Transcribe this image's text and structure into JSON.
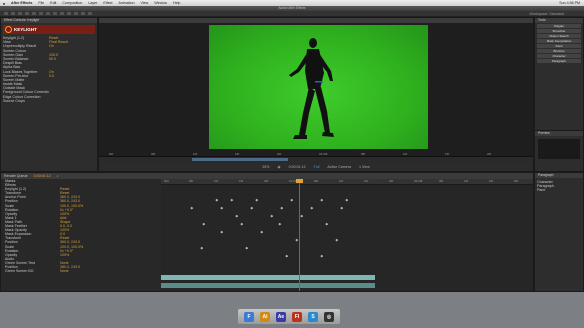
{
  "menubar": {
    "app": "After Effects",
    "items": [
      "File",
      "Edit",
      "Composition",
      "Layer",
      "Effect",
      "Animation",
      "View",
      "Window",
      "Help"
    ],
    "right": [
      "Sun 4:56 PM"
    ]
  },
  "titlebar": {
    "title": "Adobe After Effects"
  },
  "toolsbar": {
    "workspace": "Workspace: Standard"
  },
  "effects": {
    "tab": "Effect Controls: Keylight",
    "plugin_name": "KEYLIGHT",
    "rows": [
      {
        "label": "Keylight (1.2)",
        "value": "Reset"
      },
      {
        "label": "View",
        "value": "Final Result"
      },
      {
        "label": "Unpremultiply Result",
        "value": "On"
      },
      {
        "label": "Screen Colour",
        "value": ""
      },
      {
        "label": "Screen Gain",
        "value": "100.0"
      },
      {
        "label": "Screen Balance",
        "value": "50.0"
      },
      {
        "label": "Despill Bias",
        "value": ""
      },
      {
        "label": "Alpha Bias",
        "value": ""
      },
      {
        "label": "Lock Biases Together",
        "value": "On"
      },
      {
        "label": "Screen Pre-blur",
        "value": "0.0"
      },
      {
        "label": "Screen Matte",
        "value": ""
      },
      {
        "label": "Inside Mask",
        "value": ""
      },
      {
        "label": "Outside Mask",
        "value": ""
      },
      {
        "label": "Foreground Colour Correction",
        "value": ""
      },
      {
        "label": "Edge Colour Correction",
        "value": ""
      },
      {
        "label": "Source Crops",
        "value": ""
      }
    ]
  },
  "comp": {
    "ruler_labels": [
      "00f",
      "05f",
      "10f",
      "15f",
      "20f",
      "01:00f",
      "05f",
      "10f",
      "15f",
      "20f"
    ],
    "controls": {
      "zoom": "25%",
      "timecode": "0:00:01:12",
      "resolution": "Full",
      "view": "Active Camera",
      "views": "1 View"
    }
  },
  "right": {
    "tab": "Tools",
    "buttons": [
      "Wiggler",
      "Smoother",
      "Motion Sketch",
      "Mask Interpolation",
      "Paint",
      "Brushes",
      "Character",
      "Paragraph"
    ]
  },
  "preview": {
    "tab": "Preview"
  },
  "timeline": {
    "tab": "Render Queue",
    "timecode": "0:00:01:12",
    "ruler_labels": [
      "00s",
      "05f",
      "10f",
      "15f",
      "20f",
      "01:00f",
      "05f",
      "10f",
      "15f",
      "20f",
      "02:00f",
      "05f",
      "10f",
      "15f",
      "20f"
    ],
    "rows": [
      {
        "name": "Masks",
        "value": ""
      },
      {
        "name": "Effects",
        "value": ""
      },
      {
        "name": "Keylight (1.2)",
        "value": "Reset"
      },
      {
        "name": "Transform",
        "value": "Reset"
      },
      {
        "name": "Anchor Point",
        "value": "360.0, 243.0"
      },
      {
        "name": "Position",
        "value": "360.0, 243.0"
      },
      {
        "name": "Scale",
        "value": "100.0, 100.0%"
      },
      {
        "name": "Rotation",
        "value": "0x +0.0°"
      },
      {
        "name": "Opacity",
        "value": "100%"
      },
      {
        "name": "Mask 1",
        "value": "Add"
      },
      {
        "name": "Mask Path",
        "value": "Shape"
      },
      {
        "name": "Mask Feather",
        "value": "0.0, 0.0"
      },
      {
        "name": "Mask Opacity",
        "value": "100%"
      },
      {
        "name": "Mask Expansion",
        "value": "0.0"
      },
      {
        "name": "Transform",
        "value": "Reset"
      },
      {
        "name": "Position",
        "value": "360.0, 243.0"
      },
      {
        "name": "Scale",
        "value": "100.0, 100.0%"
      },
      {
        "name": "Rotation",
        "value": "0x +0.0°"
      },
      {
        "name": "Opacity",
        "value": "100%"
      },
      {
        "name": "Audio",
        "value": ""
      },
      {
        "name": "Green Screen Test",
        "value": "None"
      },
      {
        "name": "Position",
        "value": "360.0, 243.0"
      },
      {
        "name": "Green Screen BG",
        "value": "None"
      }
    ]
  },
  "info": {
    "tab": "Paragraph",
    "lines": [
      "Character",
      "Paragraph",
      "Paint"
    ]
  },
  "dock": {
    "apps": [
      {
        "label": "F",
        "color": "#3a7bd5"
      },
      {
        "label": "Ai",
        "color": "#d28a10"
      },
      {
        "label": "Ae",
        "color": "#3b3ba8"
      },
      {
        "label": "Fl",
        "color": "#c0301e"
      },
      {
        "label": "S",
        "color": "#2b8acb"
      },
      {
        "label": "◎",
        "color": "#333333"
      }
    ]
  }
}
